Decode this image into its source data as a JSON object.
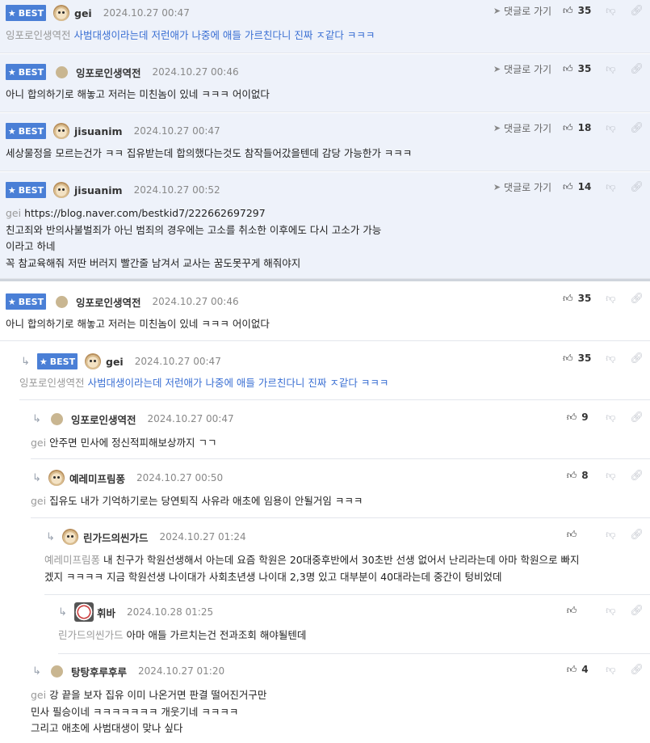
{
  "badge": "BEST",
  "goto_label": "댓글로 가기",
  "best": [
    {
      "nick": "gei",
      "date": "2024.10.27 00:47",
      "likes": "35",
      "to": "잉포로인생역전",
      "text": "사범대생이라는데 저런애가 나중에 애들 가르친다니 진짜 ㅈ같다 ㅋㅋㅋ",
      "avatar": "dog"
    },
    {
      "nick": "잉포로인생역전",
      "date": "2024.10.27 00:46",
      "likes": "35",
      "text": "아니 합의하기로 해놓고 저러는 미친놈이 있네 ㅋㅋㅋ 어이없다",
      "avatar": "dot"
    },
    {
      "nick": "jisuanim",
      "date": "2024.10.27 00:47",
      "likes": "18",
      "text": "세상물정을 모르는건가 ㅋㅋ 집유받는데 합의했다는것도 참작들어갔을텐데 감당 가능한가 ㅋㅋㅋ",
      "avatar": "dog"
    },
    {
      "nick": "jisuanim",
      "date": "2024.10.27 00:52",
      "likes": "14",
      "to": "gei",
      "lines": [
        "https://blog.naver.com/bestkid7/222662697297",
        "친고죄와 반의사불벌죄가 아닌 범죄의 경우에는 고소를 취소한 이후에도 다시 고소가 가능",
        "이라고 하네",
        "꼭 참교육해줘 저딴 버러지 빨간줄 남겨서 교사는 꿈도못꾸게 해줘야지"
      ],
      "avatar": "dog"
    }
  ],
  "thread": [
    {
      "nick": "잉포로인생역전",
      "date": "2024.10.27 00:46",
      "likes": "35",
      "text": "아니 합의하기로 해놓고 저러는 미친놈이 있네 ㅋㅋㅋ 어이없다",
      "badge": true,
      "avatar": "dot"
    },
    {
      "nick": "gei",
      "date": "2024.10.27 00:47",
      "likes": "35",
      "to": "잉포로인생역전",
      "text": "사범대생이라는데 저런애가 나중에 애들 가르친다니 진짜 ㅈ같다 ㅋㅋㅋ",
      "badge": true,
      "avatar": "dog"
    },
    {
      "nick": "잉포로인생역전",
      "date": "2024.10.27 00:47",
      "likes": "9",
      "to": "gei",
      "text": "안주면 민사에 정신적피해보상까지 ㄱㄱ",
      "avatar": "dot"
    },
    {
      "nick": "예레미프림퐁",
      "date": "2024.10.27 00:50",
      "likes": "8",
      "to": "gei",
      "text": "집유도 내가 기억하기로는 당연퇴직 사유라 애초에 임용이 안될거임 ㅋㅋㅋ",
      "avatar": "dog"
    },
    {
      "nick": "린가드의씬가드",
      "date": "2024.10.27 01:24",
      "likes": "",
      "to": "예레미프림퐁",
      "lines": [
        "내 친구가 학원선생해서 아는데 요즘 학원은 20대중후반에서 30초반 선생 없어서 난리라는데 아마 학원으로 빠지",
        "겠지 ㅋㅋㅋㅋ 지금 학원선생 나이대가 사회초년생 나이대 2,3명 있고 대부분이 40대라는데 중간이 텅비었데"
      ],
      "avatar": "dog"
    },
    {
      "nick": "휘바",
      "date": "2024.10.28 01:25",
      "likes": "",
      "to": "린가드의씬가드",
      "text": "아마 애들 가르치는건 전과조회 해야될텐데",
      "avatar": "face"
    },
    {
      "nick": "탕탕후루후루",
      "date": "2024.10.27 01:20",
      "likes": "4",
      "to": "gei",
      "lines": [
        "강 끝을 보자 집유 이미 나온거면 판결 떨어진거구만",
        "민사 필승이네 ㅋㅋㅋㅋㅋㅋㅋ 개웃기네 ㅋㅋㅋㅋ",
        "그리고 애초에 사범대생이 맞나 싶다"
      ],
      "avatar": "dot"
    }
  ]
}
